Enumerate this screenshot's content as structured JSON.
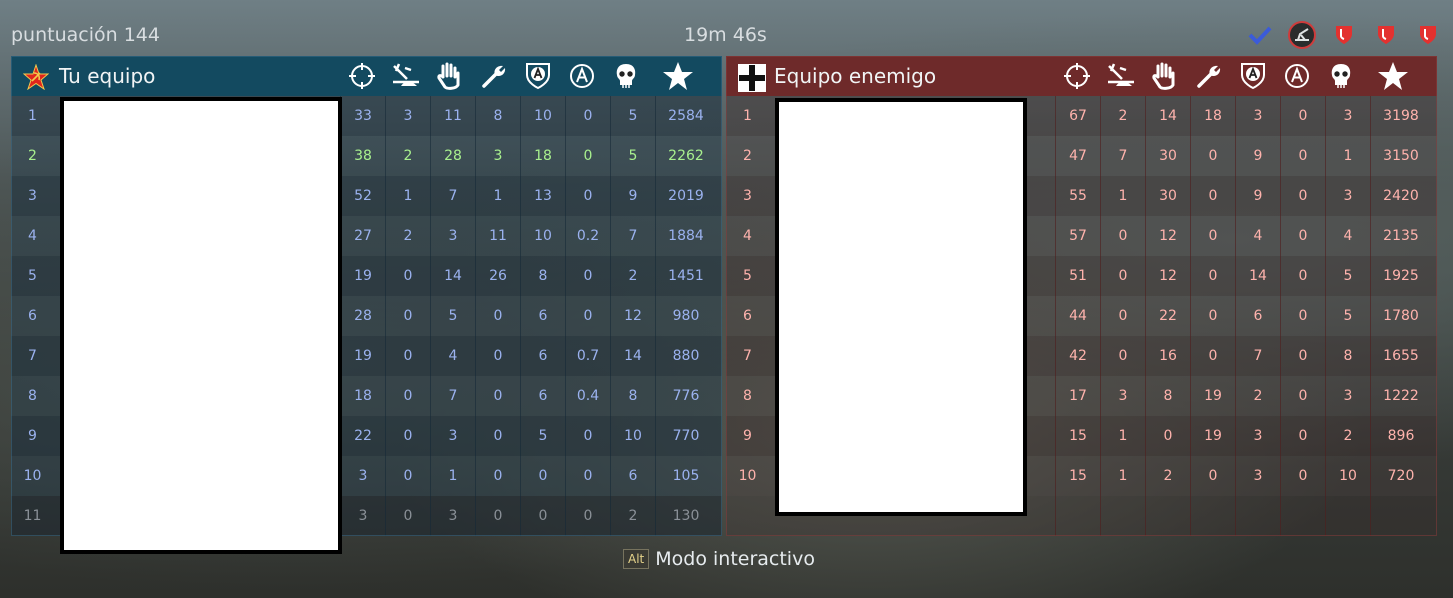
{
  "header": {
    "score": "puntuación 144",
    "timer": "19m 46s",
    "top_icons": [
      "checkmark-icon",
      "artillery-icon",
      "shield-icon",
      "shield-icon",
      "shield-icon"
    ]
  },
  "stat_columns": [
    "crosshair-icon",
    "plane-down-icon",
    "hand-icon",
    "wrench-icon",
    "shield-a-icon",
    "circle-a-icon",
    "skull-icon",
    "star-icon"
  ],
  "left_team": {
    "name": "Tu equipo",
    "flag": "soviet-star-icon",
    "rows": [
      {
        "num": "1",
        "stats": [
          "33",
          "3",
          "11",
          "8",
          "10",
          "0",
          "5",
          "2584"
        ]
      },
      {
        "num": "2",
        "stats": [
          "38",
          "2",
          "28",
          "3",
          "18",
          "0",
          "5",
          "2262"
        ]
      },
      {
        "num": "3",
        "stats": [
          "52",
          "1",
          "7",
          "1",
          "13",
          "0",
          "9",
          "2019"
        ]
      },
      {
        "num": "4",
        "stats": [
          "27",
          "2",
          "3",
          "11",
          "10",
          "0.2",
          "7",
          "1884"
        ]
      },
      {
        "num": "5",
        "stats": [
          "19",
          "0",
          "14",
          "26",
          "8",
          "0",
          "2",
          "1451"
        ]
      },
      {
        "num": "6",
        "stats": [
          "28",
          "0",
          "5",
          "0",
          "6",
          "0",
          "12",
          "980"
        ]
      },
      {
        "num": "7",
        "stats": [
          "19",
          "0",
          "4",
          "0",
          "6",
          "0.7",
          "14",
          "880"
        ]
      },
      {
        "num": "8",
        "stats": [
          "18",
          "0",
          "7",
          "0",
          "6",
          "0.4",
          "8",
          "776"
        ]
      },
      {
        "num": "9",
        "stats": [
          "22",
          "0",
          "3",
          "0",
          "5",
          "0",
          "10",
          "770"
        ]
      },
      {
        "num": "10",
        "stats": [
          "3",
          "0",
          "1",
          "0",
          "0",
          "0",
          "6",
          "105"
        ]
      },
      {
        "num": "11",
        "stats": [
          "3",
          "0",
          "3",
          "0",
          "0",
          "0",
          "2",
          "130"
        ]
      }
    ]
  },
  "right_team": {
    "name": "Equipo enemigo",
    "flag": "iron-cross-icon",
    "rows": [
      {
        "num": "1",
        "stats": [
          "67",
          "2",
          "14",
          "18",
          "3",
          "0",
          "3",
          "3198"
        ]
      },
      {
        "num": "2",
        "stats": [
          "47",
          "7",
          "30",
          "0",
          "9",
          "0",
          "1",
          "3150"
        ]
      },
      {
        "num": "3",
        "stats": [
          "55",
          "1",
          "30",
          "0",
          "9",
          "0",
          "3",
          "2420"
        ]
      },
      {
        "num": "4",
        "stats": [
          "57",
          "0",
          "12",
          "0",
          "4",
          "0",
          "4",
          "2135"
        ]
      },
      {
        "num": "5",
        "stats": [
          "51",
          "0",
          "12",
          "0",
          "14",
          "0",
          "5",
          "1925"
        ]
      },
      {
        "num": "6",
        "stats": [
          "44",
          "0",
          "22",
          "0",
          "6",
          "0",
          "5",
          "1780"
        ]
      },
      {
        "num": "7",
        "stats": [
          "42",
          "0",
          "16",
          "0",
          "7",
          "0",
          "8",
          "1655"
        ]
      },
      {
        "num": "8",
        "stats": [
          "17",
          "3",
          "8",
          "19",
          "2",
          "0",
          "3",
          "1222"
        ]
      },
      {
        "num": "9",
        "stats": [
          "15",
          "1",
          "0",
          "19",
          "3",
          "0",
          "2",
          "896"
        ]
      },
      {
        "num": "10",
        "stats": [
          "15",
          "1",
          "2",
          "0",
          "3",
          "0",
          "10",
          "720"
        ]
      },
      {
        "num": "",
        "stats": [
          "",
          "",
          "",
          "",
          "",
          "",
          "",
          ""
        ]
      }
    ]
  },
  "footer": {
    "key": "Alt",
    "label": "Modo interactivo"
  }
}
